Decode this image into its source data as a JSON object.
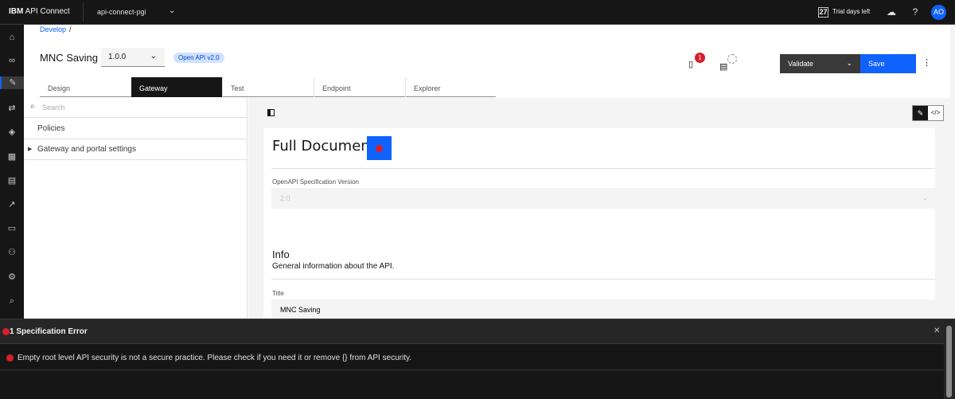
{
  "topbar": {
    "brand_bold": "IBM",
    "brand_rest": " API Connect",
    "catalog": "api-connect-pgi",
    "trial_days": "27",
    "trial_label": "Trial days left",
    "avatar": "AO",
    "icons": [
      "cloud-upload-icon",
      "help-icon"
    ]
  },
  "leftnav": {
    "icons": [
      "home-icon",
      "apps-icon",
      "edit-icon",
      "exchange-icon",
      "shield-icon",
      "grid-icon",
      "document-icon",
      "analytics-icon",
      "monitor-icon",
      "users-icon",
      "settings-icon",
      "search-icon"
    ],
    "active_index": 2
  },
  "header": {
    "breadcrumb": "Develop",
    "breadcrumb_sep": "/",
    "api_title": "MNC Saving",
    "version": "1.0.0",
    "oa_tag": "Open API v2.0",
    "notification_count": "1",
    "validate_label": "Validate",
    "save_label": "Save"
  },
  "tabs": [
    {
      "label": "Design"
    },
    {
      "label": "Gateway",
      "active": true
    },
    {
      "label": "Test"
    },
    {
      "label": "Endpoint"
    },
    {
      "label": "Explorer"
    }
  ],
  "leftpane": {
    "search_placeholder": "Search",
    "items": [
      {
        "label": "Policies"
      },
      {
        "label": "Gateway and portal settings",
        "expandable": true
      }
    ]
  },
  "document": {
    "title": "Full Document",
    "oas_version_label": "OpenAPI Specification Version",
    "oas_version_value": "2.0",
    "info_title": "Info",
    "info_desc": "General information about the API.",
    "title_label": "Title",
    "title_value": "MNC Saving"
  },
  "errors": {
    "heading": "1 Specification Error",
    "messages": [
      "Empty root level API security is not a secure practice. Please check if you need it or remove {} from API security."
    ]
  },
  "colors": {
    "accent": "#0f62fe",
    "error": "#da1e28",
    "dark": "#161616"
  }
}
